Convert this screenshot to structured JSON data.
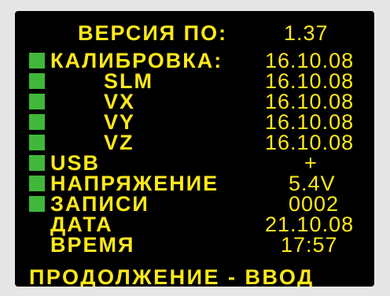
{
  "screen": {
    "version_label": "ВЕРСИЯ ПО:",
    "version_value": "1.37",
    "calibration": {
      "label": "КАЛИБРОВКА:",
      "value": "16.10.08",
      "status_color": "#3fb83a"
    },
    "sensors": [
      {
        "label": "SLM",
        "value": "16.10.08"
      },
      {
        "label": "VX",
        "value": "16.10.08"
      },
      {
        "label": "VY",
        "value": "16.10.08"
      },
      {
        "label": "VZ",
        "value": "16.10.08"
      }
    ],
    "usb": {
      "label": "USB",
      "value": "+"
    },
    "voltage": {
      "label": "НАПРЯЖЕНИЕ",
      "value": "5.4V"
    },
    "records": {
      "label": "ЗАПИСИ",
      "value": "0002"
    },
    "date": {
      "label": "ДАТА",
      "value": "21.10.08"
    },
    "time": {
      "label": "ВРЕМЯ",
      "value": "17:57"
    },
    "footer": "ПРОДОЛЖЕНИЕ - ВВОД",
    "colors": {
      "text": "#ffe81a",
      "background": "#000000",
      "indicator": "#3fb83a",
      "frame": "#e6e6e6"
    }
  }
}
